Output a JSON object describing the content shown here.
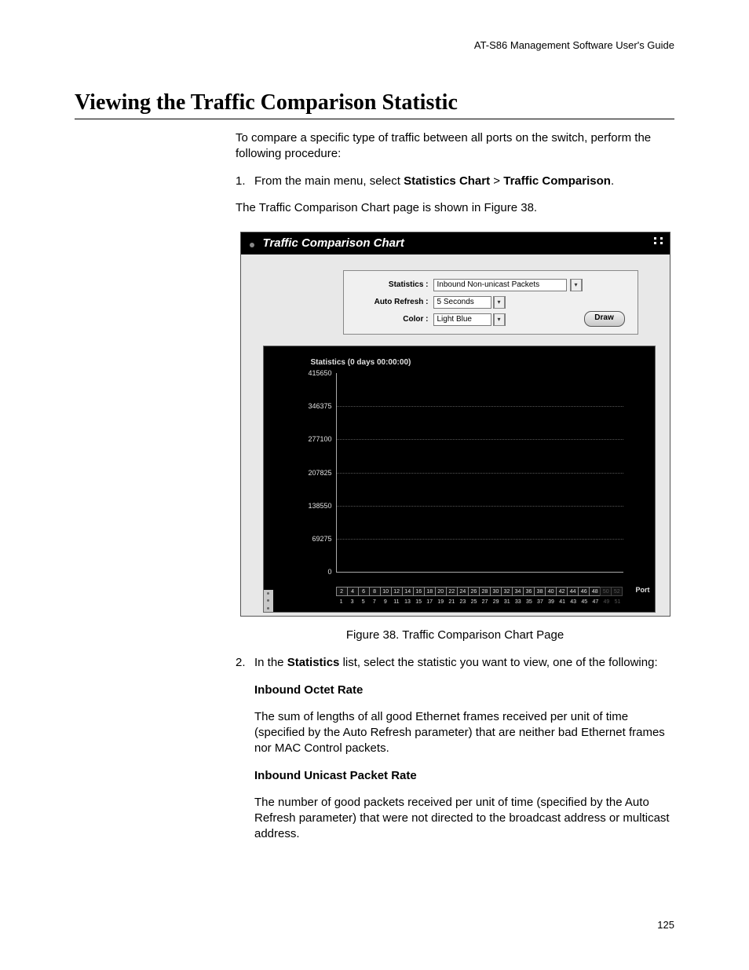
{
  "doc": {
    "header_right": "AT-S86 Management Software User's Guide",
    "h1": "Viewing the Traffic Comparison Statistic",
    "intro": "To compare a specific type of traffic between all ports on the switch, perform the following procedure:",
    "step1_num": "1.",
    "step1_text_a": "From the main menu, select ",
    "step1_bold_a": "Statistics Chart",
    "step1_gt": " > ",
    "step1_bold_b": "Traffic Comparison",
    "step1_period": ".",
    "step1_after": "The Traffic Comparison Chart page is shown in Figure 38.",
    "figure_caption": "Figure 38. Traffic Comparison Chart Page",
    "step2_num": "2.",
    "step2_text_a": "In the ",
    "step2_bold": "Statistics",
    "step2_text_b": " list, select the statistic you want to view, one of the following:",
    "def1_head": "Inbound Octet Rate",
    "def1_body": "The sum of lengths of all good Ethernet frames received per unit of time (specified by the Auto Refresh parameter) that are neither bad Ethernet frames nor MAC Control packets.",
    "def2_head": "Inbound Unicast Packet Rate",
    "def2_body": "The number of good packets received per unit of time (specified by the Auto Refresh parameter) that were not directed to the broadcast address or multicast address.",
    "page_number": "125"
  },
  "app": {
    "title": "Traffic Comparison Chart",
    "controls": {
      "statistics_label": "Statistics :",
      "statistics_value": "Inbound Non-unicast Packets",
      "autorefresh_label": "Auto Refresh :",
      "autorefresh_value": "5 Seconds",
      "color_label": "Color :",
      "color_value": "Light Blue",
      "draw": "Draw"
    },
    "chart_header": "Statistics (0 days 00:00:00)",
    "port_label": "Port"
  },
  "chart_data": {
    "type": "bar",
    "title": "Statistics (0 days 00:00:00)",
    "xlabel": "Port",
    "ylabel": "",
    "ylim": [
      0,
      415650
    ],
    "y_ticks": [
      0,
      69275,
      138550,
      207825,
      277100,
      346375,
      415650
    ],
    "categories_odd": [
      1,
      3,
      5,
      7,
      9,
      11,
      13,
      15,
      17,
      19,
      21,
      23,
      25,
      27,
      29,
      31,
      33,
      35,
      37,
      39,
      41,
      43,
      45,
      47,
      49,
      51
    ],
    "categories_even": [
      2,
      4,
      6,
      8,
      10,
      12,
      14,
      16,
      18,
      20,
      22,
      24,
      26,
      28,
      30,
      32,
      34,
      36,
      38,
      40,
      42,
      44,
      46,
      48,
      50,
      52
    ],
    "dimmed_ports": [
      49,
      50,
      51,
      52
    ],
    "values": [
      0,
      0,
      0,
      0,
      0,
      0,
      0,
      0,
      0,
      0,
      0,
      0,
      0,
      0,
      0,
      0,
      0,
      0,
      0,
      0,
      0,
      0,
      0,
      0,
      0,
      0,
      0,
      0,
      0,
      0,
      0,
      0,
      0,
      0,
      0,
      0,
      0,
      0,
      0,
      0,
      0,
      0,
      0,
      0,
      0,
      0,
      0,
      0,
      0,
      0,
      0,
      0
    ]
  }
}
